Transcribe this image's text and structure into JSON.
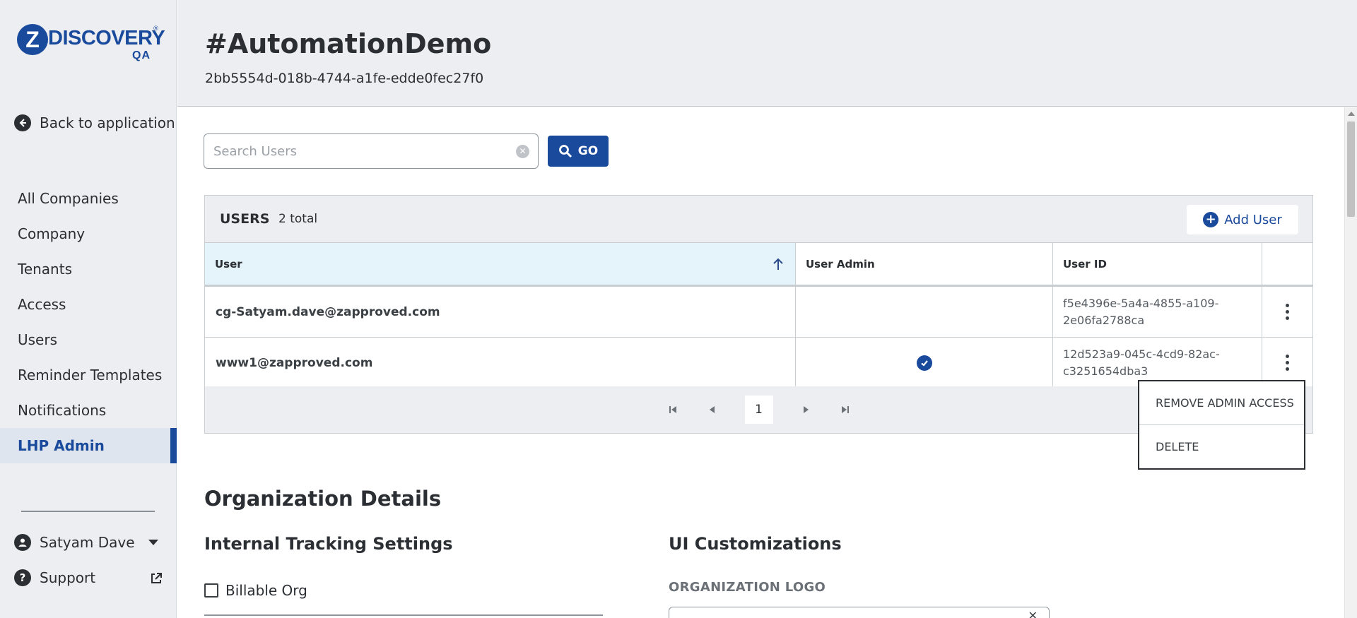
{
  "brand": {
    "logo_letter": "Z",
    "logo_text": "DISCOVERY",
    "logo_reg": "®",
    "env": "QA",
    "accent_color": "#1a4a9c"
  },
  "sidebar": {
    "back_label": "Back to application",
    "items": [
      {
        "label": "All Companies",
        "active": false
      },
      {
        "label": "Company",
        "active": false
      },
      {
        "label": "Tenants",
        "active": false
      },
      {
        "label": "Access",
        "active": false
      },
      {
        "label": "Users",
        "active": false
      },
      {
        "label": "Reminder Templates",
        "active": false
      },
      {
        "label": "Notifications",
        "active": false
      },
      {
        "label": "LHP Admin",
        "active": true
      }
    ],
    "user_name": "Satyam Dave",
    "support_label": "Support"
  },
  "header": {
    "title": "#AutomationDemo",
    "subtitle": "2bb5554d-018b-4744-a1fe-edde0fec27f0"
  },
  "search": {
    "placeholder": "Search Users",
    "value": "",
    "go_label": "GO"
  },
  "users_panel": {
    "title": "USERS",
    "count": "2 total",
    "add_label": "Add User",
    "columns": [
      "User",
      "User Admin",
      "User ID"
    ],
    "rows": [
      {
        "user": "cg-Satyam.dave@zapproved.com",
        "admin": false,
        "id": "f5e4396e-5a4a-4855-a109-2e06fa2788ca"
      },
      {
        "user": "www1@zapproved.com",
        "admin": true,
        "id": "12d523a9-045c-4cd9-82ac-c3251654dba3"
      }
    ],
    "page": "1"
  },
  "context_menu": {
    "items": [
      "REMOVE ADMIN ACCESS",
      "DELETE"
    ]
  },
  "org": {
    "title": "Organization Details",
    "internal_title": "Internal Tracking Settings",
    "billable_label": "Billable Org",
    "billable_checked": false,
    "ui_title": "UI Customizations",
    "logo_label": "ORGANIZATION LOGO"
  }
}
